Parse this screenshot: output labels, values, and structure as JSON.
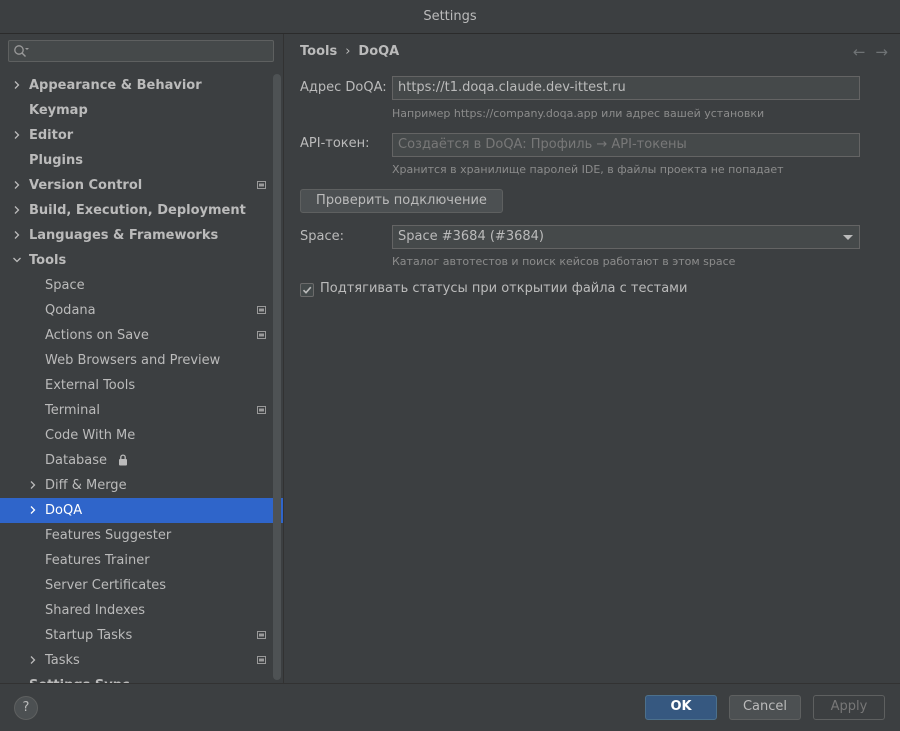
{
  "window": {
    "title": "Settings"
  },
  "search": {
    "placeholder": "",
    "icon": "search-icon"
  },
  "tree": [
    {
      "label": "Appearance & Behavior",
      "bold": true,
      "chevron": "right",
      "level": 0
    },
    {
      "label": "Keymap",
      "bold": true,
      "chevron": null,
      "level": 0
    },
    {
      "label": "Editor",
      "bold": true,
      "chevron": "right",
      "level": 0
    },
    {
      "label": "Plugins",
      "bold": true,
      "chevron": null,
      "level": 0
    },
    {
      "label": "Version Control",
      "bold": true,
      "chevron": "right",
      "level": 0,
      "project": true
    },
    {
      "label": "Build, Execution, Deployment",
      "bold": true,
      "chevron": "right",
      "level": 0
    },
    {
      "label": "Languages & Frameworks",
      "bold": true,
      "chevron": "right",
      "level": 0
    },
    {
      "label": "Tools",
      "bold": true,
      "chevron": "down",
      "level": 0
    },
    {
      "label": "Space",
      "level": 1
    },
    {
      "label": "Qodana",
      "level": 1,
      "project": true
    },
    {
      "label": "Actions on Save",
      "level": 1,
      "project": true
    },
    {
      "label": "Web Browsers and Preview",
      "level": 1
    },
    {
      "label": "External Tools",
      "level": 1
    },
    {
      "label": "Terminal",
      "level": 1,
      "project": true
    },
    {
      "label": "Code With Me",
      "level": 1
    },
    {
      "label": "Database",
      "level": 1,
      "lock": true
    },
    {
      "label": "Diff & Merge",
      "level": 1,
      "chevron": "right"
    },
    {
      "label": "DoQA",
      "level": 1,
      "chevron": "right",
      "selected": true
    },
    {
      "label": "Features Suggester",
      "level": 1
    },
    {
      "label": "Features Trainer",
      "level": 1
    },
    {
      "label": "Server Certificates",
      "level": 1
    },
    {
      "label": "Shared Indexes",
      "level": 1
    },
    {
      "label": "Startup Tasks",
      "level": 1,
      "project": true
    },
    {
      "label": "Tasks",
      "level": 1,
      "chevron": "right",
      "project": true
    },
    {
      "label": "Settings Sync",
      "bold": true,
      "chevron": null,
      "level": 0
    }
  ],
  "breadcrumb": {
    "parent": "Tools",
    "separator": "›",
    "current": "DoQA"
  },
  "form": {
    "address_label": "Адрес DoQA:",
    "address_value": "https://t1.doqa.claude.dev-ittest.ru",
    "address_hint": "Например https://company.doqa.app или адрес вашей установки",
    "token_label": "API-токен:",
    "token_placeholder": "Создаётся в DoQA: Профиль → API-токены",
    "token_hint": "Хранится в хранилище паролей IDE, в файлы проекта не попадает",
    "check_button": "Проверить подключение",
    "space_label": "Space:",
    "space_value": "Space #3684 (#3684)",
    "space_hint": "Каталог автотестов и поиск кейсов работают в этом space",
    "fetch_checkbox_label": "Подтягивать статусы при открытии файла с тестами",
    "fetch_checkbox_checked": true
  },
  "footer": {
    "help": "?",
    "ok": "OK",
    "cancel": "Cancel",
    "apply": "Apply"
  },
  "colors": {
    "selection": "#2f65ca",
    "ok_button": "#365880"
  }
}
